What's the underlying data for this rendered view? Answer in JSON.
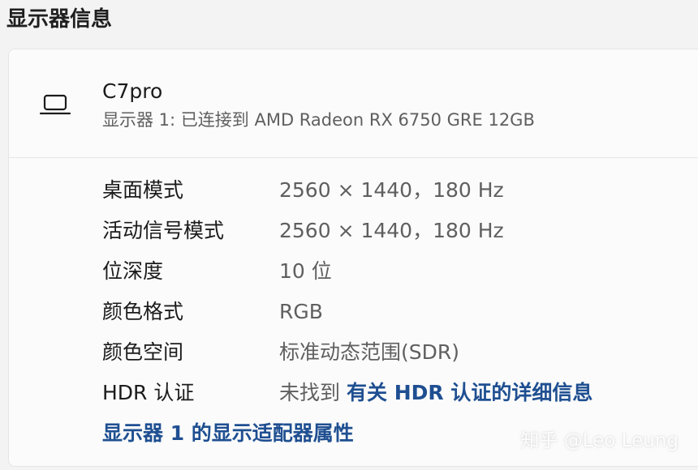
{
  "section_title": "显示器信息",
  "monitor": {
    "icon": "laptop-icon",
    "name": "C7pro",
    "subtitle": "显示器 1: 已连接到 AMD Radeon RX 6750 GRE 12GB"
  },
  "rows": [
    {
      "label": "桌面模式",
      "value": "2560 × 1440，180 Hz"
    },
    {
      "label": "活动信号模式",
      "value": "2560 × 1440，180 Hz"
    },
    {
      "label": "位深度",
      "value": "10 位"
    },
    {
      "label": "颜色格式",
      "value": "RGB"
    },
    {
      "label": "颜色空间",
      "value": "标准动态范围(SDR)"
    },
    {
      "label": "HDR 认证",
      "value": "未找到",
      "link": "有关 HDR 认证的详细信息"
    }
  ],
  "adapter_link": "显示器 1 的显示适配器属性",
  "watermark": "知乎 @Leo Leung",
  "colors": {
    "link": "#1f4f91",
    "secondary_text": "#5f5f5f",
    "card_bg": "#fbfbfb",
    "page_bg": "#f3f3f3"
  }
}
